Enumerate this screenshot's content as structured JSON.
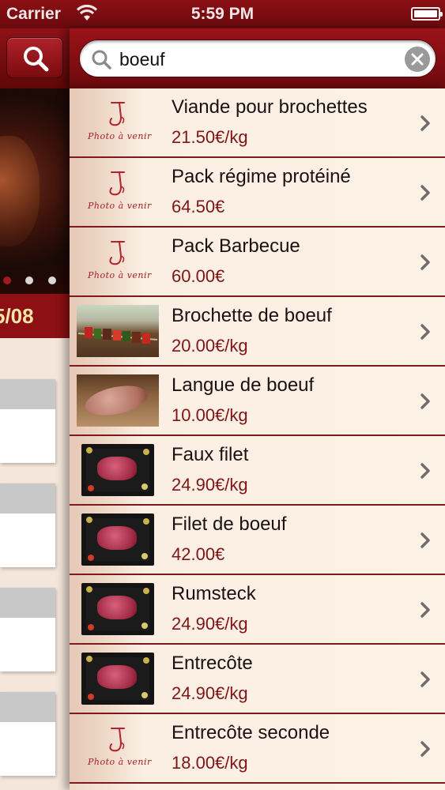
{
  "status_bar": {
    "carrier": "Carrier",
    "time": "5:59 PM"
  },
  "left_panel": {
    "date": "5/08"
  },
  "search": {
    "query": "boeuf"
  },
  "placeholder_caption": "Photo à venir",
  "results": [
    {
      "name": "Viande pour brochettes",
      "price": "21.50€/kg",
      "image": "placeholder"
    },
    {
      "name": "Pack régime protéiné",
      "price": "64.50€",
      "image": "placeholder"
    },
    {
      "name": "Pack Barbecue",
      "price": "60.00€",
      "image": "placeholder"
    },
    {
      "name": "Brochette de boeuf",
      "price": "20.00€/kg",
      "image": "skewer-photo"
    },
    {
      "name": "Langue de boeuf",
      "price": "10.00€/kg",
      "image": "tongue-photo"
    },
    {
      "name": "Faux filet",
      "price": "24.90€/kg",
      "image": "steak-photo"
    },
    {
      "name": "Filet de boeuf",
      "price": "42.00€",
      "image": "steak-photo"
    },
    {
      "name": "Rumsteck",
      "price": "24.90€/kg",
      "image": "steak-photo"
    },
    {
      "name": "Entrecôte",
      "price": "24.90€/kg",
      "image": "steak-photo"
    },
    {
      "name": "Entrecôte seconde",
      "price": "18.00€/kg",
      "image": "placeholder"
    }
  ],
  "colors": {
    "header": "#8b0f14",
    "price": "#7e1517",
    "divider": "#7c1a1e"
  }
}
